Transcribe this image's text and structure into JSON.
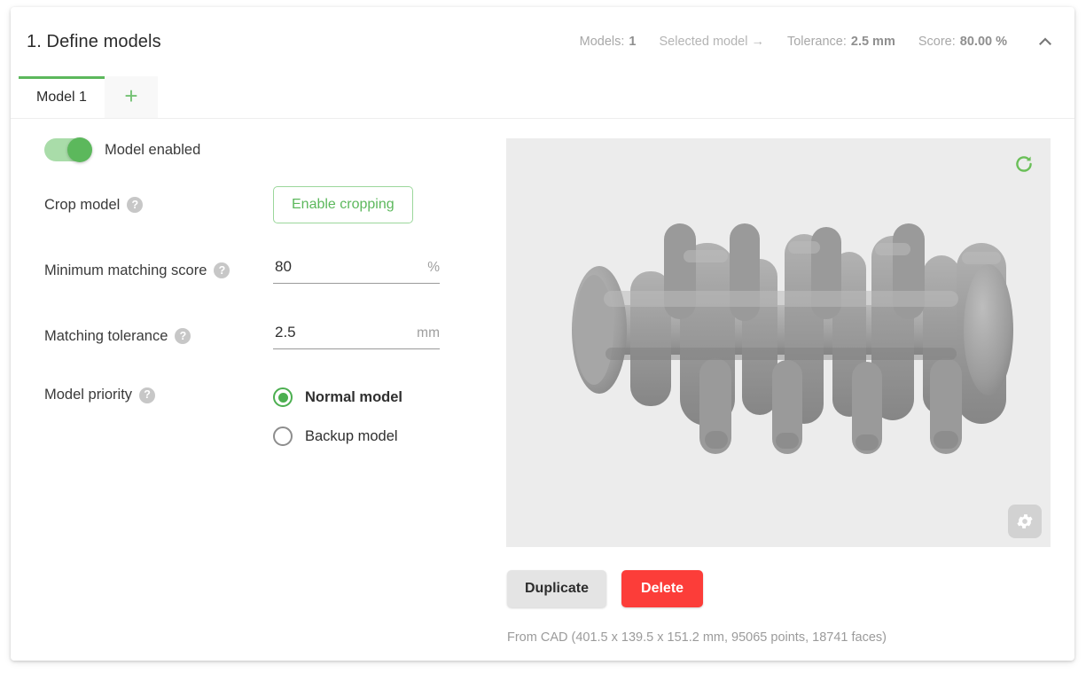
{
  "header": {
    "title": "1. Define models",
    "stats": [
      {
        "label": "Models:",
        "value": "1"
      },
      {
        "label": "Selected model →",
        "value": ""
      },
      {
        "label": "Tolerance:",
        "value": "2.5 mm"
      },
      {
        "label": "Score:",
        "value": "80.00 %"
      }
    ],
    "collapse_icon": "chevron-up-icon"
  },
  "tabs": {
    "items": [
      {
        "label": "Model 1"
      }
    ],
    "add_label": "+"
  },
  "form": {
    "toggle": {
      "label": "Model enabled",
      "state": "on"
    },
    "crop": {
      "label": "Crop model",
      "help": "?",
      "button": "Enable cropping"
    },
    "min_score": {
      "label": "Minimum matching score",
      "help": "?",
      "value": "80",
      "unit": "%"
    },
    "tolerance": {
      "label": "Matching tolerance",
      "help": "?",
      "value": "2.5",
      "unit": "mm"
    },
    "priority": {
      "label": "Model priority",
      "help": "?",
      "options": [
        {
          "label": "Normal model",
          "selected": true
        },
        {
          "label": "Backup model",
          "selected": false
        }
      ]
    }
  },
  "viewer": {
    "refresh_icon": "refresh-icon",
    "settings_icon": "gear-icon",
    "actions": {
      "duplicate": "Duplicate",
      "delete": "Delete"
    },
    "cad_info": "From CAD (401.5 x 139.5 x 151.2 mm, 95065 points, 18741 faces)"
  },
  "colors": {
    "accent_green": "#5cb85c",
    "danger_red": "#fc3d39",
    "viewer_bg": "#ececec"
  }
}
